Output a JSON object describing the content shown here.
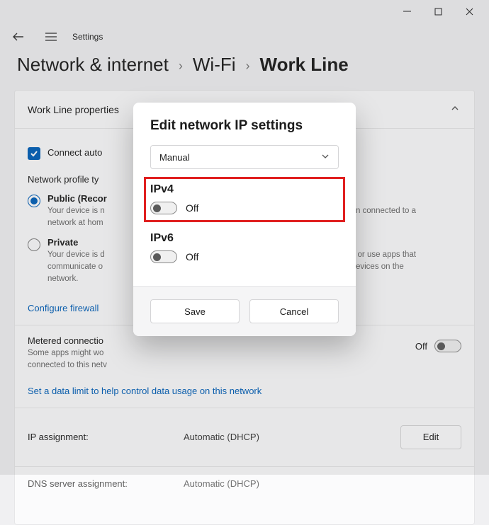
{
  "titlebar": {
    "app": "Settings"
  },
  "breadcrumb": {
    "a": "Network & internet",
    "b": "Wi-Fi",
    "c": "Work Line"
  },
  "panel": {
    "header": "Work Line properties",
    "connect_auto": "Connect auto",
    "profile_label": "Network profile ty",
    "public": {
      "title": "Public (Recor",
      "desc": "Your device is n\nnetwork at hom",
      "desc_right": "nen connected to a"
    },
    "private": {
      "title": "Private",
      "desc": "Your device is d\ncommunicate o\nnetwork.",
      "desc_right": "ing or use apps that\nd devices on the"
    },
    "firewall_link": "Configure firewall",
    "metered": {
      "title": "Metered connectio",
      "desc": "Some apps might wo\nconnected to this netv",
      "state": "Off"
    },
    "data_limit_link": "Set a data limit to help control data usage on this network",
    "ip_assignment": {
      "label": "IP assignment:",
      "value": "Automatic (DHCP)",
      "btn": "Edit"
    },
    "dns": {
      "label": "DNS server assignment:",
      "value": "Automatic (DHCP)"
    }
  },
  "dialog": {
    "title": "Edit network IP settings",
    "mode": "Manual",
    "ipv4": {
      "label": "IPv4",
      "state": "Off"
    },
    "ipv6": {
      "label": "IPv6",
      "state": "Off"
    },
    "save": "Save",
    "cancel": "Cancel"
  }
}
